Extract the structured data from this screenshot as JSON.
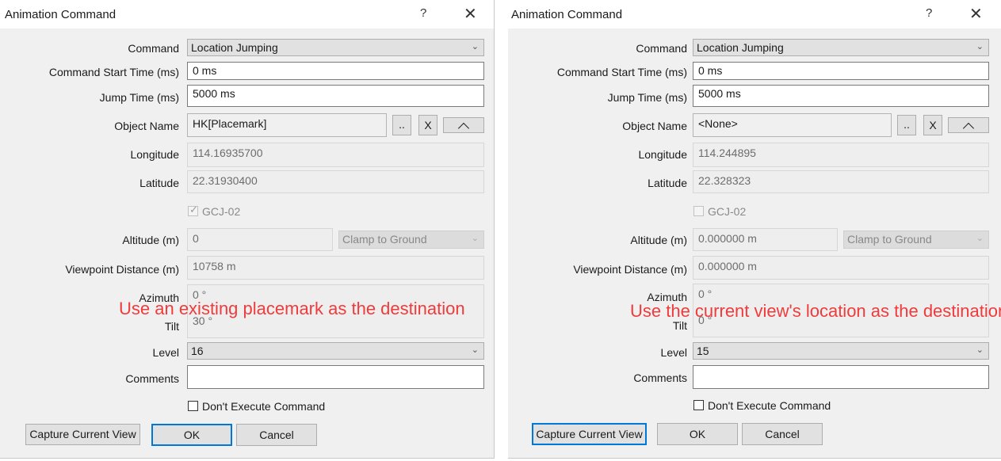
{
  "dialogs": [
    {
      "title": "Animation Command",
      "help_glyph": "?",
      "close_glyph": "✕",
      "labels": {
        "command": "Command",
        "start_time": "Command Start Time (ms)",
        "jump_time": "Jump Time (ms)",
        "object_name": "Object Name",
        "longitude": "Longitude",
        "latitude": "Latitude",
        "altitude": "Altitude (m)",
        "viewpoint_distance": "Viewpoint Distance (m)",
        "azimuth": "Azimuth",
        "tilt": "Tilt",
        "level": "Level",
        "comments": "Comments"
      },
      "command": "Location Jumping",
      "start_time": "0 ms",
      "jump_time": "5000 ms",
      "object_name": "HK[Placemark]",
      "browse_btn": "..",
      "clear_btn": "X",
      "longitude": "114.16935700",
      "latitude": "22.31930400",
      "gcj": {
        "label": "GCJ-02",
        "checked": true
      },
      "altitude": "0",
      "altitude_mode": "Clamp to Ground",
      "viewpoint_distance": "10758 m",
      "azimuth": "0 °",
      "tilt": "30 °",
      "level": "16",
      "comments": "",
      "dont_execute": "Don't Execute Command",
      "capture_btn": "Capture Current View",
      "ok_btn": "OK",
      "cancel_btn": "Cancel",
      "annotation": "Use an existing placemark as the destination"
    },
    {
      "title": "Animation Command",
      "help_glyph": "?",
      "close_glyph": "✕",
      "labels": {
        "command": "Command",
        "start_time": "Command Start Time (ms)",
        "jump_time": "Jump Time (ms)",
        "object_name": "Object Name",
        "longitude": "Longitude",
        "latitude": "Latitude",
        "altitude": "Altitude (m)",
        "viewpoint_distance": "Viewpoint Distance (m)",
        "azimuth": "Azimuth",
        "tilt": "Tilt",
        "level": "Level",
        "comments": "Comments"
      },
      "command": "Location Jumping",
      "start_time": "0 ms",
      "jump_time": "5000 ms",
      "object_name": "<None>",
      "browse_btn": "..",
      "clear_btn": "X",
      "longitude": "114.244895",
      "latitude": "22.328323",
      "gcj": {
        "label": "GCJ-02",
        "checked": false
      },
      "altitude": "0.000000 m",
      "altitude_mode": "Clamp to Ground",
      "viewpoint_distance": "0.000000 m",
      "azimuth": "0 °",
      "tilt": "0 °",
      "level": "15",
      "comments": "",
      "dont_execute": "Don't Execute Command",
      "capture_btn": "Capture Current View",
      "ok_btn": "OK",
      "cancel_btn": "Cancel",
      "annotation": "Use the current view's location as the destination"
    }
  ],
  "colors": {
    "annotation": "#ef3b3b",
    "focus_border": "#0078d7",
    "dialog_bg": "#f0f0f0"
  }
}
